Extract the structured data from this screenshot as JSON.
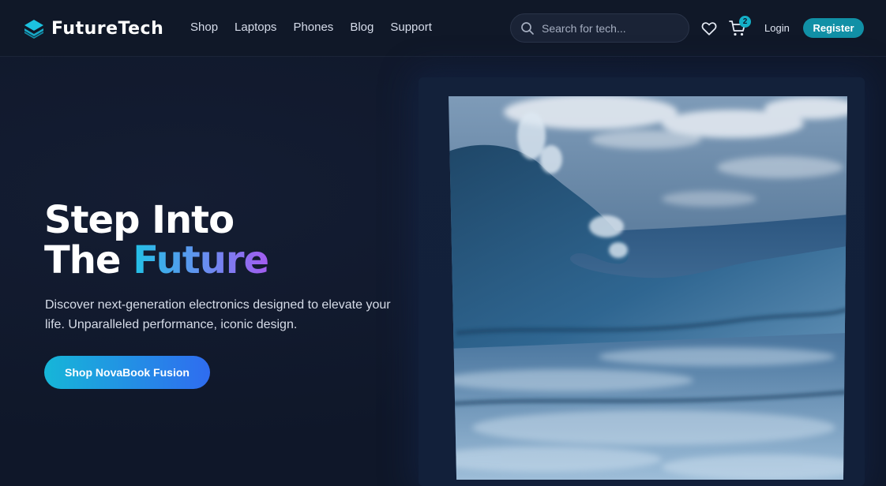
{
  "brand": {
    "name": "FutureTech",
    "logo_icon": "layers-icon",
    "accent": "#14b0c8"
  },
  "nav": {
    "items": [
      "Shop",
      "Laptops",
      "Phones",
      "Blog",
      "Support"
    ]
  },
  "search": {
    "placeholder": "Search for tech...",
    "value": ""
  },
  "header_actions": {
    "wishlist_icon": "heart-icon",
    "cart_icon": "cart-icon",
    "cart_count": "2",
    "login_label": "Login",
    "register_label": "Register"
  },
  "hero": {
    "title_line1": "Step Into",
    "title_line2_plain": "The",
    "title_line2_highlight": "Future",
    "description": "Discover next-generation electronics designed to elevate your life. Unparalleled performance, iconic design.",
    "cta_label": "Shop NovaBook Fusion"
  },
  "colors": {
    "background": "#0f1729",
    "register_button": "#1190a6",
    "cta_gradient_start": "#16b6d8",
    "cta_gradient_end": "#2f6cf0",
    "title_gradient": [
      "#22c1e6",
      "#6a8cf0",
      "#a35cf0"
    ]
  }
}
